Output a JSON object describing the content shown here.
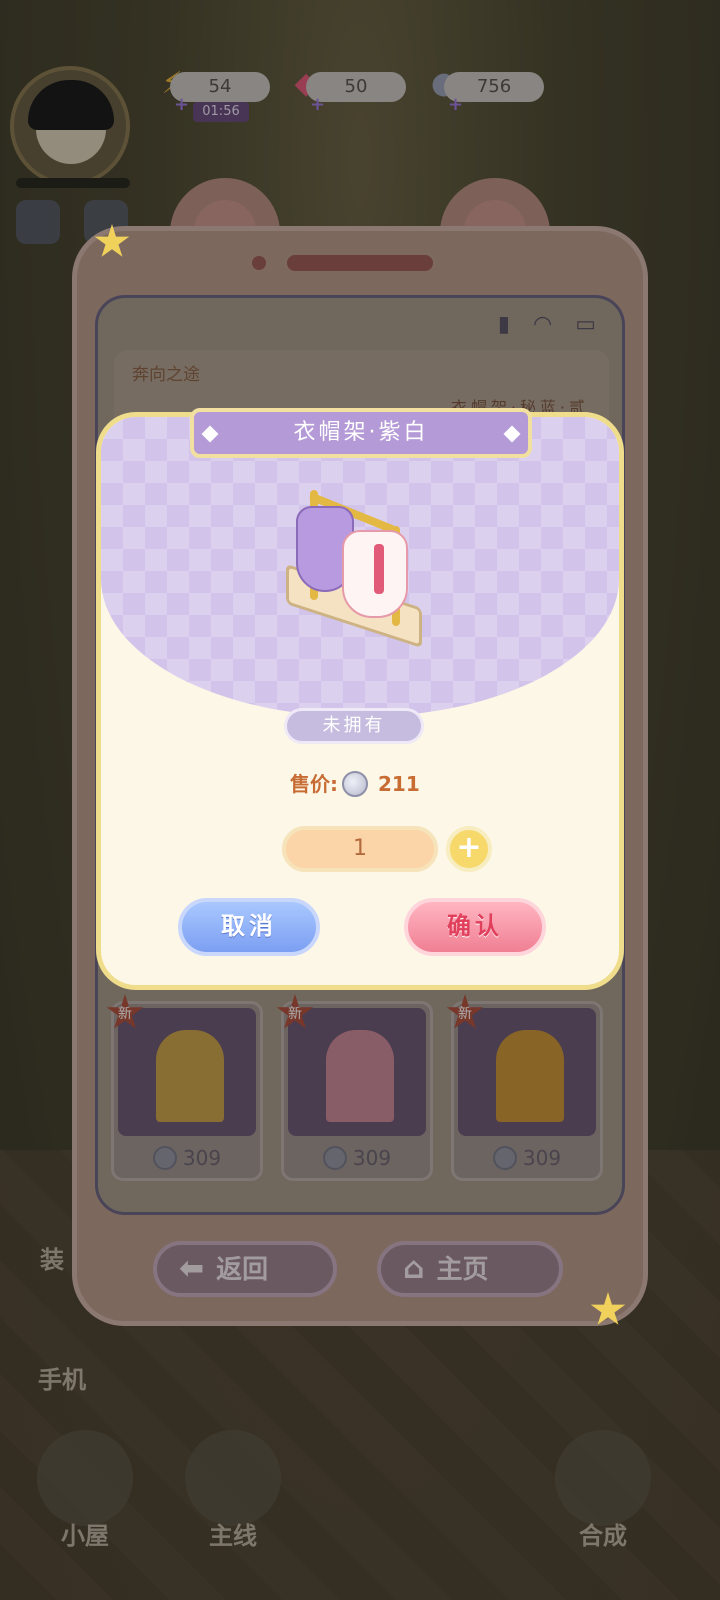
{
  "hud": {
    "energy": "54",
    "energy_timer": "01:56",
    "gems": "50",
    "coins": "756"
  },
  "phone": {
    "header_title": "奔向之途",
    "header_subtitle": "衣帽架·秘蓝·贰"
  },
  "item_cards": [
    {
      "badge": "新",
      "price": "309",
      "curtain_color": "#c9a24a"
    },
    {
      "badge": "新",
      "price": "309",
      "curtain_color": "#c98a9a"
    },
    {
      "badge": "新",
      "price": "309",
      "curtain_color": "#c9943a"
    }
  ],
  "nav": {
    "back_label": "返回",
    "home_label": "主页"
  },
  "bottom_nav": {
    "side_label_1": "装",
    "side_label_2": "手机",
    "item_1": "小屋",
    "item_2": "主线",
    "item_3": "合成"
  },
  "modal": {
    "title": "衣帽架·紫白",
    "status": "未拥有",
    "price_label": "售价:",
    "price_value": "211",
    "quantity": "1",
    "plus_label": "+",
    "cancel_label": "取消",
    "confirm_label": "确认"
  }
}
